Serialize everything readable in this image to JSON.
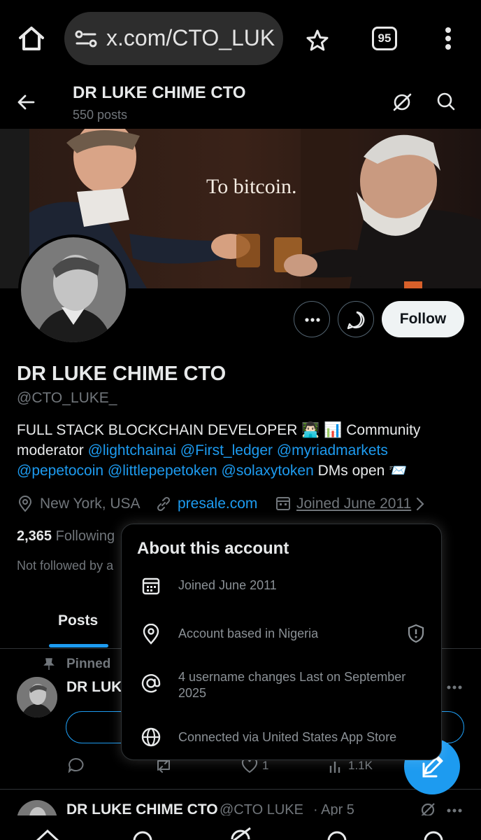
{
  "browser": {
    "url": "x.com/CTO_LUK",
    "tab_count": "95"
  },
  "header": {
    "title": "DR LUKE CHIME CTO",
    "posts_count": "550 posts"
  },
  "banner": {
    "caption": "To bitcoin."
  },
  "actions": {
    "follow_label": "Follow"
  },
  "profile": {
    "display_name": "DR LUKE CHIME CTO",
    "handle": "@CTO_LUKE_",
    "bio": {
      "line1": "FULL STACK BLOCKCHAIN DEVELOPER 👨🏻‍💻 📊 Community",
      "line2_prefix": "moderator",
      "mention_1": "@lightchainai",
      "mention_2": "@First_ledger",
      "mention_3": "@myriadmarkets",
      "mention_4": "@pepetocoin",
      "mention_5": "@littlepepetoken",
      "mention_6": "@solaxytoken",
      "suffix": "DMs open 📨"
    },
    "location": "New York, USA",
    "website": "presale.com",
    "joined": "Joined June 2011",
    "following_count": "2,365",
    "following_label": "Following",
    "not_followed": "Not followed by a"
  },
  "tabs": {
    "posts": "Posts"
  },
  "posts": [
    {
      "pinned_label": "Pinned",
      "author": "DR LUK",
      "replies": "",
      "reposts": "",
      "likes": "1",
      "views": "1.1K"
    },
    {
      "author": "DR LUKE CHIME CTO",
      "handle": "@CTO LUKE",
      "date": "· Apr 5"
    }
  ],
  "about_popover": {
    "title": "About this account",
    "rows": [
      {
        "icon": "calendar-icon",
        "text": "Joined June 2011"
      },
      {
        "icon": "location-pin-icon",
        "text": "Account based in Nigeria"
      },
      {
        "icon": "at-sign-icon",
        "text": "4 username changes Last on September 2025"
      },
      {
        "icon": "globe-icon",
        "text": "Connected via United States App Store"
      }
    ]
  },
  "colors": {
    "accent": "#1d9bf0",
    "background": "#000000",
    "text_primary": "#e7e9ea",
    "text_secondary": "#71767b"
  }
}
